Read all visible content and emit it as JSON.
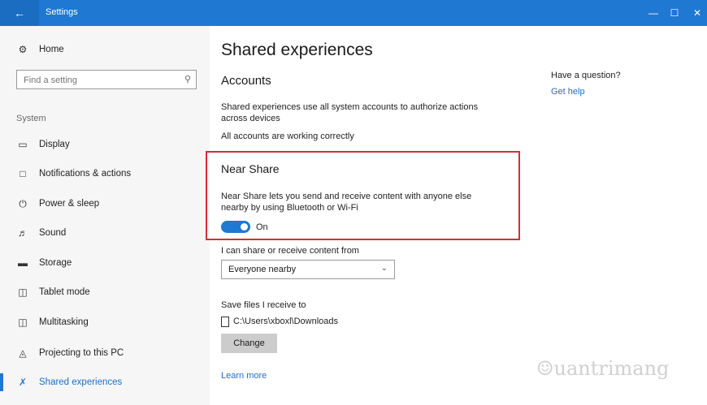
{
  "window": {
    "title": "Settings",
    "back_icon": "back-arrow-icon",
    "minimize": "—",
    "maximize": "☐",
    "close": "✕"
  },
  "sidebar": {
    "home_label": "Home",
    "search_placeholder": "Find a setting",
    "section_label": "System",
    "items": [
      {
        "label": "Display",
        "icon": "display-icon"
      },
      {
        "label": "Notifications & actions",
        "icon": "notifications-icon"
      },
      {
        "label": "Power & sleep",
        "icon": "power-icon"
      },
      {
        "label": "Sound",
        "icon": "sound-icon"
      },
      {
        "label": "Storage",
        "icon": "storage-icon"
      },
      {
        "label": "Tablet mode",
        "icon": "tablet-icon"
      },
      {
        "label": "Multitasking",
        "icon": "multitasking-icon"
      },
      {
        "label": "Projecting to this PC",
        "icon": "projecting-icon"
      },
      {
        "label": "Shared experiences",
        "icon": "shared-experiences-icon",
        "selected": true
      }
    ]
  },
  "main": {
    "title": "Shared experiences",
    "accounts": {
      "heading": "Accounts",
      "desc_line1": "Shared experiences use all system accounts to authorize actions",
      "desc_line2": "across devices",
      "status": "All accounts are working correctly"
    },
    "near_share": {
      "heading": "Near Share",
      "desc_line1": "Near Share lets you send and receive content with anyone else",
      "desc_line2": "nearby by using Bluetooth or Wi-Fi",
      "toggle_state": "On"
    },
    "share_from_label": "I can share or receive content from",
    "share_from_value": "Everyone nearby",
    "save_label": "Save files I receive to",
    "save_path": "C:\\Users\\xboxl\\Downloads",
    "change_button": "Change",
    "learn_more": "Learn more"
  },
  "help": {
    "question": "Have a question?",
    "get_help": "Get help"
  },
  "watermark": "uantrimang",
  "colors": {
    "accent": "#1f78d1",
    "highlight_box": "#d42d3a"
  }
}
